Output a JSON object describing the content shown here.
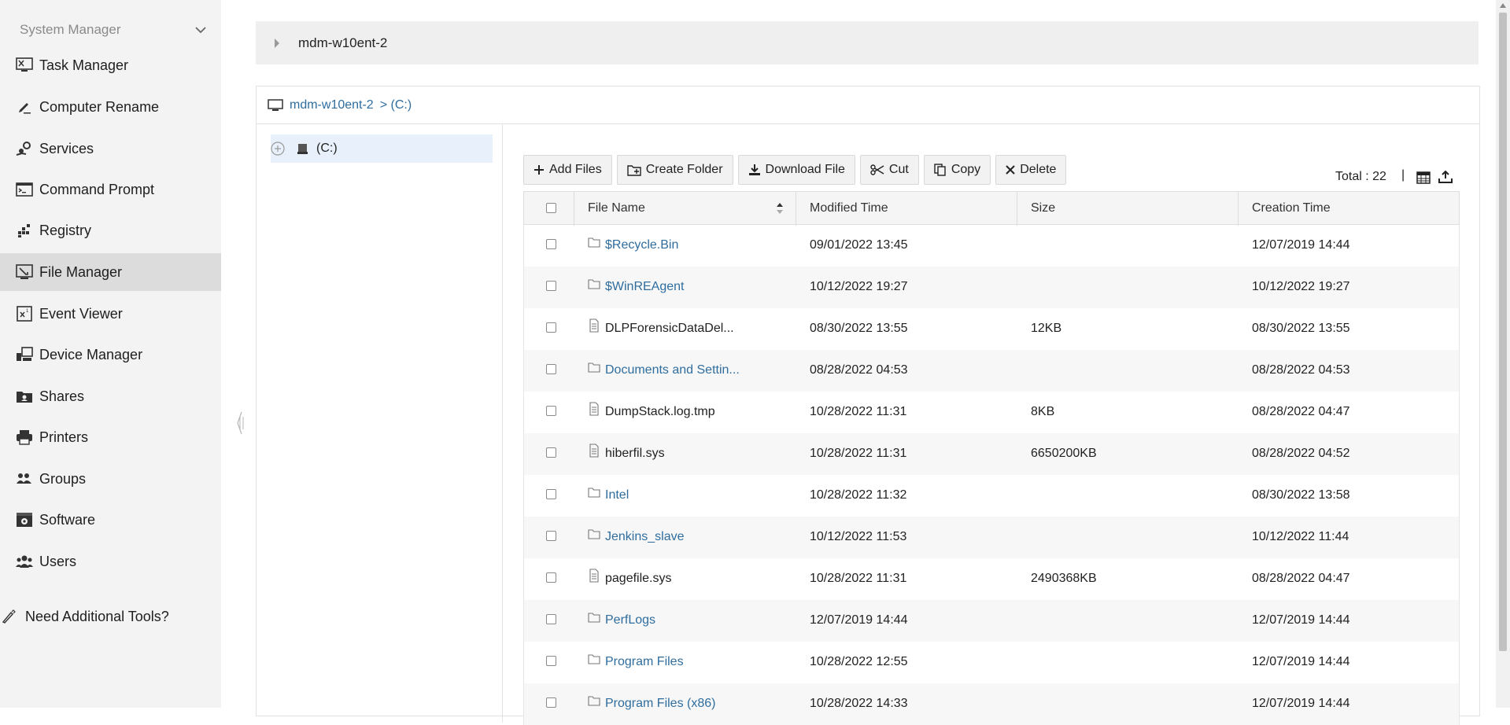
{
  "sidebar": {
    "header": "System Manager",
    "items": [
      {
        "label": "Task Manager",
        "icon": "task-manager-icon"
      },
      {
        "label": "Computer Rename",
        "icon": "pencil-icon"
      },
      {
        "label": "Services",
        "icon": "services-icon"
      },
      {
        "label": "Command Prompt",
        "icon": "terminal-icon"
      },
      {
        "label": "Registry",
        "icon": "registry-icon"
      },
      {
        "label": "File Manager",
        "icon": "file-manager-icon",
        "active": true
      },
      {
        "label": "Event Viewer",
        "icon": "event-viewer-icon"
      },
      {
        "label": "Device Manager",
        "icon": "device-manager-icon"
      },
      {
        "label": "Shares",
        "icon": "shares-icon"
      },
      {
        "label": "Printers",
        "icon": "printer-icon"
      },
      {
        "label": "Groups",
        "icon": "groups-icon"
      },
      {
        "label": "Software",
        "icon": "software-icon"
      },
      {
        "label": "Users",
        "icon": "users-icon"
      }
    ],
    "tools_label": "Need Additional Tools?"
  },
  "device": {
    "name": "mdm-w10ent-2"
  },
  "breadcrumb": {
    "computer": "mdm-w10ent-2",
    "path": "> (C:)"
  },
  "tree": {
    "root_label": "(C:)"
  },
  "toolbar": {
    "add_files": "Add Files",
    "create_folder": "Create Folder",
    "download_file": "Download File",
    "cut": "Cut",
    "copy": "Copy",
    "delete": "Delete"
  },
  "total": "Total : 22",
  "separator": "|",
  "table": {
    "headers": {
      "name": "File Name",
      "modified": "Modified Time",
      "size": "Size",
      "created": "Creation Time"
    },
    "rows": [
      {
        "name": "$Recycle.Bin",
        "type": "folder",
        "modified": "09/01/2022 13:45",
        "size": "",
        "created": "12/07/2019 14:44"
      },
      {
        "name": "$WinREAgent",
        "type": "folder",
        "modified": "10/12/2022 19:27",
        "size": "",
        "created": "10/12/2022 19:27"
      },
      {
        "name": "DLPForensicDataDel...",
        "type": "file",
        "modified": "08/30/2022 13:55",
        "size": "12KB",
        "created": "08/30/2022 13:55"
      },
      {
        "name": "Documents and Settin...",
        "type": "folder",
        "modified": "08/28/2022 04:53",
        "size": "",
        "created": "08/28/2022 04:53"
      },
      {
        "name": "DumpStack.log.tmp",
        "type": "file",
        "modified": "10/28/2022 11:31",
        "size": "8KB",
        "created": "08/28/2022 04:47"
      },
      {
        "name": "hiberfil.sys",
        "type": "file",
        "modified": "10/28/2022 11:31",
        "size": "6650200KB",
        "created": "08/28/2022 04:52"
      },
      {
        "name": "Intel",
        "type": "folder",
        "modified": "10/28/2022 11:32",
        "size": "",
        "created": "08/30/2022 13:58"
      },
      {
        "name": "Jenkins_slave",
        "type": "folder",
        "modified": "10/12/2022 11:53",
        "size": "",
        "created": "10/12/2022 11:44"
      },
      {
        "name": "pagefile.sys",
        "type": "file",
        "modified": "10/28/2022 11:31",
        "size": "2490368KB",
        "created": "08/28/2022 04:47"
      },
      {
        "name": "PerfLogs",
        "type": "folder",
        "modified": "12/07/2019 14:44",
        "size": "",
        "created": "12/07/2019 14:44"
      },
      {
        "name": "Program Files",
        "type": "folder",
        "modified": "10/28/2022 12:55",
        "size": "",
        "created": "12/07/2019 14:44"
      },
      {
        "name": "Program Files (x86)",
        "type": "folder",
        "modified": "10/28/2022 14:33",
        "size": "",
        "created": "12/07/2019 14:44"
      }
    ]
  },
  "colors": {
    "link": "#2f6d9e",
    "sidebar_bg": "#f3f3f3",
    "active_item": "#dcdcdc",
    "selected_node": "#e8f1fb"
  }
}
